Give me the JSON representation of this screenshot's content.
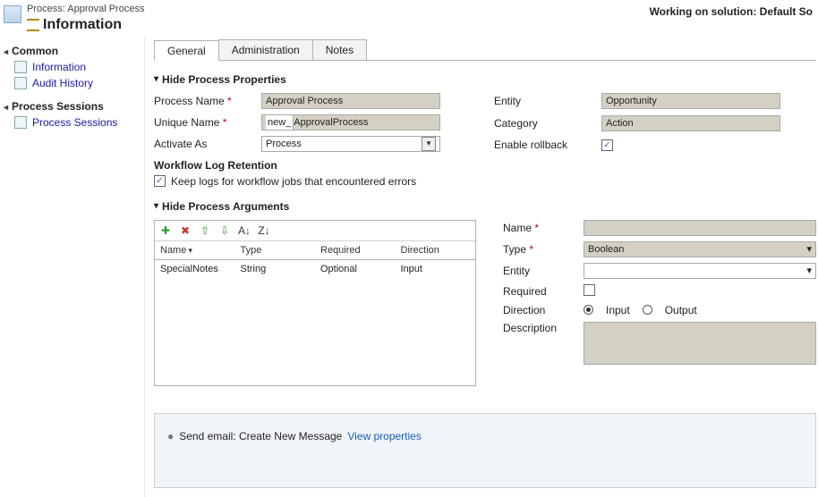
{
  "header": {
    "process_label": "Process: Approval Process",
    "info_title": "Information",
    "working_on": "Working on solution: Default So"
  },
  "sidebar": {
    "groups": [
      {
        "title": "Common",
        "items": [
          "Information",
          "Audit History"
        ]
      },
      {
        "title": "Process Sessions",
        "items": [
          "Process Sessions"
        ]
      }
    ]
  },
  "tabs": [
    "General",
    "Administration",
    "Notes"
  ],
  "sections": {
    "properties_title": "Hide Process Properties",
    "arguments_title": "Hide Process Arguments"
  },
  "props": {
    "process_name_label": "Process Name",
    "process_name_value": "Approval Process",
    "unique_name_label": "Unique Name",
    "unique_name_prefix": "new_",
    "unique_name_value": "ApprovalProcess",
    "activate_as_label": "Activate As",
    "activate_as_value": "Process",
    "entity_label": "Entity",
    "entity_value": "Opportunity",
    "category_label": "Category",
    "category_value": "Action",
    "enable_rollback_label": "Enable rollback",
    "enable_rollback_checked": true,
    "workflow_log_title": "Workflow Log Retention",
    "keep_logs_label": "Keep logs for workflow jobs that encountered errors",
    "keep_logs_checked": true
  },
  "args_grid": {
    "headers": [
      "Name",
      "Type",
      "Required",
      "Direction"
    ],
    "rows": [
      {
        "name": "SpecialNotes",
        "type": "String",
        "required": "Optional",
        "direction": "Input"
      }
    ]
  },
  "arg_form": {
    "name_label": "Name",
    "name_value": "",
    "type_label": "Type",
    "type_value": "Boolean",
    "entity_label": "Entity",
    "entity_value": "",
    "required_label": "Required",
    "required_checked": false,
    "direction_label": "Direction",
    "direction_input": "Input",
    "direction_output": "Output",
    "direction_selected": "Input",
    "description_label": "Description"
  },
  "step": {
    "text": "Send email:  Create New Message",
    "view_props": "View properties"
  }
}
